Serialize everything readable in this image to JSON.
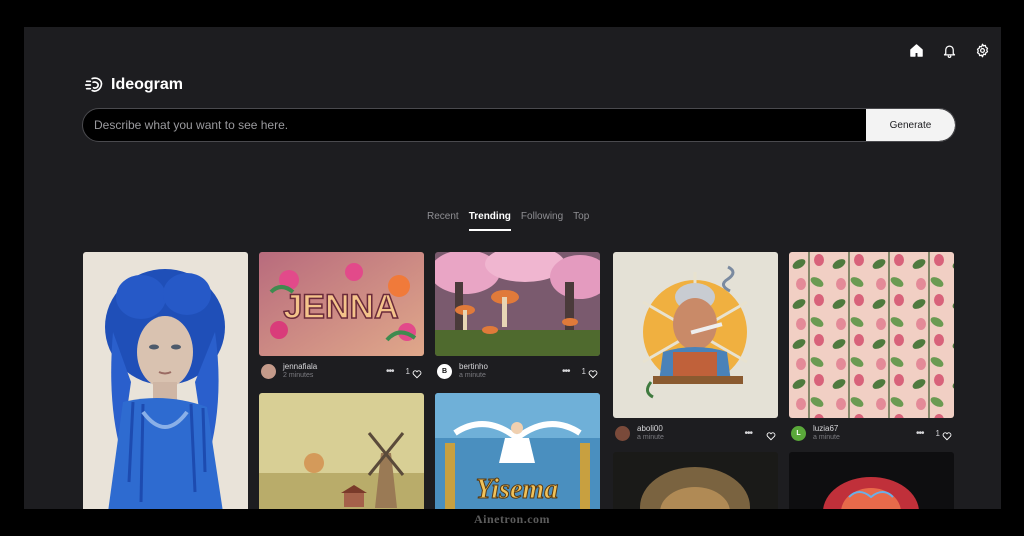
{
  "header": {
    "icons": [
      "home-icon",
      "bell-icon",
      "gear-icon"
    ],
    "logo_text": "Ideogram"
  },
  "search": {
    "placeholder": "Describe what you want to see here.",
    "value": "",
    "button_label": "Generate"
  },
  "tabs": [
    {
      "label": "Recent",
      "active": false
    },
    {
      "label": "Trending",
      "active": true
    },
    {
      "label": "Following",
      "active": false
    },
    {
      "label": "Top",
      "active": false
    }
  ],
  "cards": [
    {
      "user": "jennafiala",
      "time": "2 minutes",
      "likes": "1",
      "image_text": "JENNA"
    },
    {
      "user": "bertinho",
      "time": "a minute",
      "likes": "1",
      "avatar_text": "B"
    },
    {
      "user": "aboli00",
      "time": "a minute",
      "likes": ""
    },
    {
      "user": "luzia67",
      "time": "a minute",
      "likes": "1",
      "avatar_text": "L"
    }
  ],
  "second_row_image_text": "Yisema",
  "colors": {
    "background": "#1d1d20",
    "outer": "#000000",
    "button_bg": "#f3f3f3",
    "accent_text": "#ffffff"
  },
  "watermark": "Ainetron.com"
}
